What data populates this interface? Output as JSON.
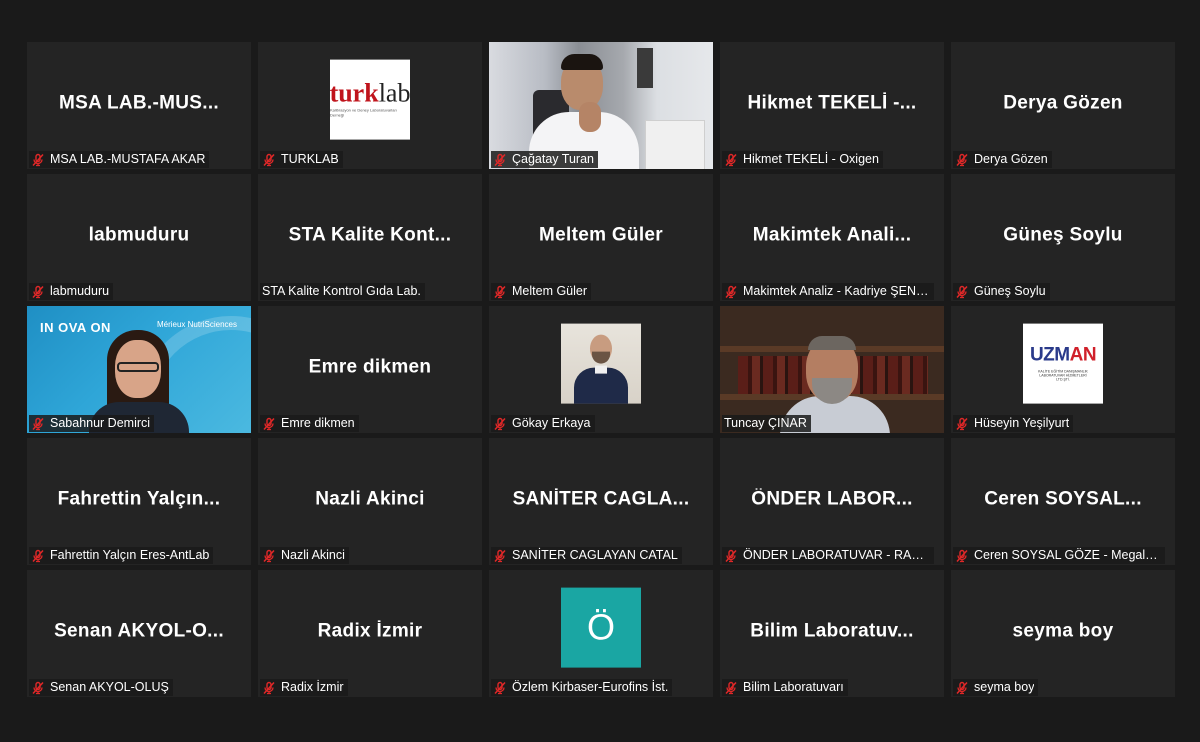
{
  "participants": [
    {
      "name": "MSA LAB.-MUSTAFA AKAR",
      "display": "MSA  LAB.-MUS..."
    },
    {
      "name": "TURKLAB",
      "logo": "turklab"
    },
    {
      "name": "Çağatay Turan",
      "video": "cagatay"
    },
    {
      "name": "Hikmet TEKELİ - Oxigen",
      "display": "Hikmet  TEKELİ  -..."
    },
    {
      "name": "Derya Gözen",
      "display": "Derya Gözen"
    },
    {
      "name": "labmuduru",
      "display": "labmuduru"
    },
    {
      "name": "STA Kalite Kontrol Gıda Lab.",
      "display": "STA  Kalite  Kont..."
    },
    {
      "name": "Meltem Güler",
      "display": "Meltem Güler"
    },
    {
      "name": "Makimtek Analiz - Kadriye ŞENER",
      "display": "Makimtek  Anali..."
    },
    {
      "name": "Güneş Soylu",
      "display": "Güneş Soylu"
    },
    {
      "name": "Sabahnur Demirci",
      "video": "sabahnur"
    },
    {
      "name": "Emre dikmen",
      "display": "Emre dikmen"
    },
    {
      "name": "Gökay Erkaya",
      "logo": "gokay"
    },
    {
      "name": "Tuncay ÇINAR",
      "video": "tuncay",
      "speaking": true
    },
    {
      "name": "Hüseyin Yeşilyurt",
      "logo": "uzman"
    },
    {
      "name": "Fahrettin Yalçın Eres-AntLab",
      "display": "Fahrettin  Yalçın..."
    },
    {
      "name": "Nazli Akinci",
      "display": "Nazli Akinci"
    },
    {
      "name": "SANİTER CAGLAYAN CATAL",
      "display": "SANİTER  CAGLA..."
    },
    {
      "name": "ÖNDER LABORATUVAR - RAHMA...",
      "display": "ÖNDER  LABOR..."
    },
    {
      "name": "Ceren SOYSAL GÖZE - Megalab M...",
      "display": "Ceren  SOYSAL..."
    },
    {
      "name": "Senan AKYOL-OLUŞ",
      "display": "Senan  AKYOL-O..."
    },
    {
      "name": "Radix İzmir",
      "display": "Radix İzmir"
    },
    {
      "name": "Özlem Kirbaser-Eurofins İst.",
      "logo": "ozlem"
    },
    {
      "name": "Bilim Laboratuvarı",
      "display": "Bilim  Laboratuv..."
    },
    {
      "name": "seyma boy",
      "display": "seyma boy"
    }
  ],
  "logos": {
    "turklab_main": "turk",
    "turklab_accent": "lab",
    "turklab_sub": "Kalibrasyon ve Deney Laboratuvarları Derneği",
    "uzman_main": "UZM",
    "uzman_accent": "AN",
    "uzman_sub": "KALİTE EĞİTİM DANIŞMANLIK LABORATUVAR HİZMETLERİ LTD.ŞTİ.",
    "ozlem_initial": "Ö",
    "innovation_text": "IN   OVA   ON",
    "merieux_text": "Mérieux NutriSciences"
  },
  "icons": {
    "muted": "mic-muted-icon"
  },
  "colors": {
    "background": "#1a1a1a",
    "tile": "#242424",
    "speaking_border": "#e4ec6d",
    "muted_red": "#e02828"
  }
}
